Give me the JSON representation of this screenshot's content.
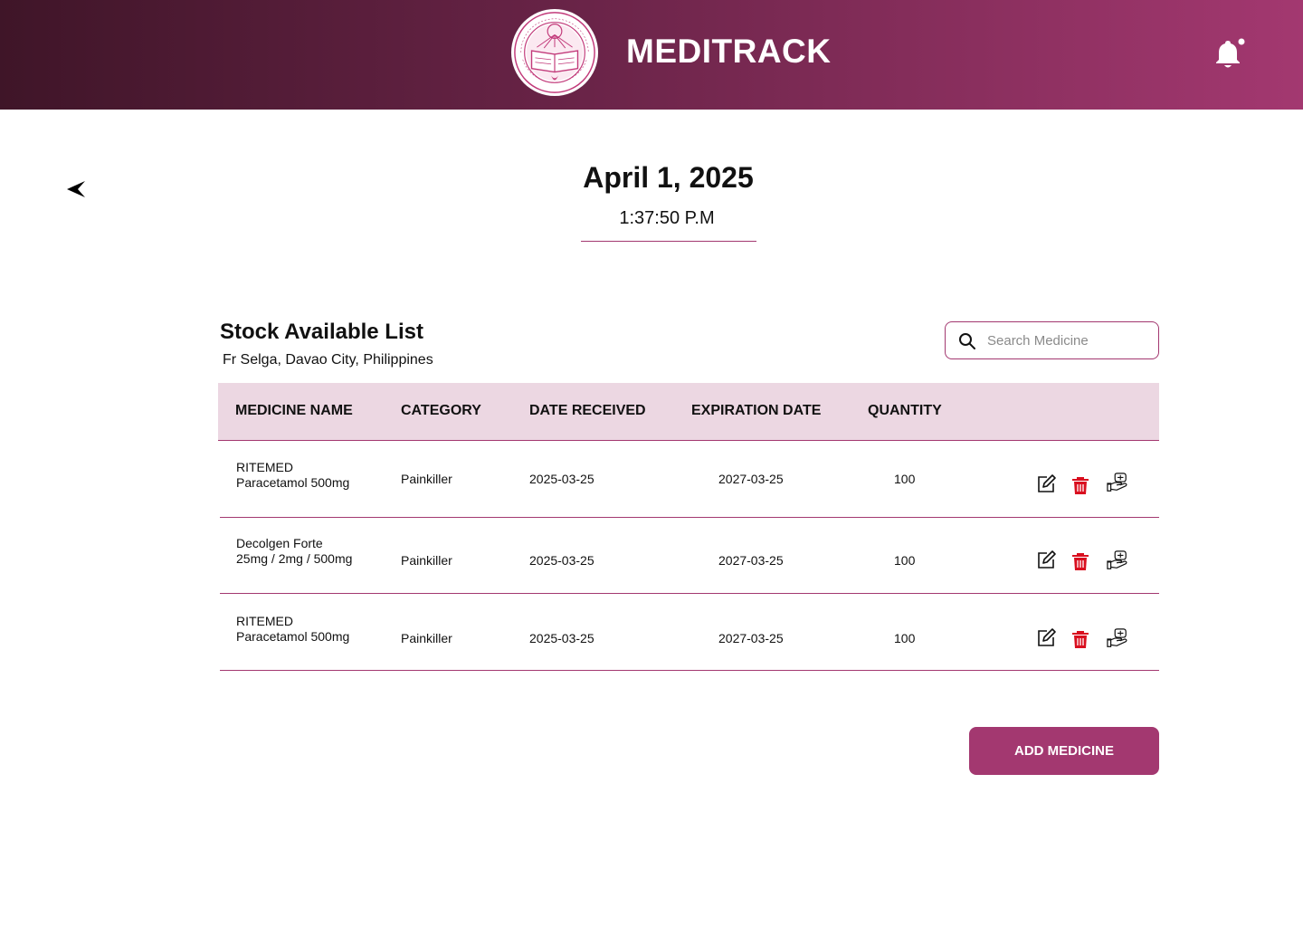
{
  "header": {
    "app_title": "MEDITRACK",
    "logo_icon": "university-seal-icon",
    "notification_icon": "bell-icon",
    "brand_color": "#a33870"
  },
  "datetime": {
    "date": "April 1, 2025",
    "time": "1:37:50 P.M"
  },
  "section": {
    "title": "Stock Available List",
    "subtitle": "Fr Selga, Davao City, Philippines"
  },
  "search": {
    "placeholder": "Search Medicine",
    "value": ""
  },
  "table": {
    "columns": [
      "MEDICINE NAME",
      "CATEGORY",
      "DATE RECEIVED",
      "EXPIRATION DATE",
      "QUANTITY"
    ],
    "rows": [
      {
        "name": "RITEMED Paracetamol 500mg",
        "category": "Painkiller",
        "date_received": "2025-03-25",
        "expiration_date": "2027-03-25",
        "quantity": "100"
      },
      {
        "name": "Decolgen Forte 25mg / 2mg / 500mg",
        "category": "Painkiller",
        "date_received": "2025-03-25",
        "expiration_date": "2027-03-25",
        "quantity": "100"
      },
      {
        "name": "RITEMED Paracetamol 500mg",
        "category": "Painkiller",
        "date_received": "2025-03-25",
        "expiration_date": "2027-03-25",
        "quantity": "100"
      }
    ],
    "row_action_icons": [
      "edit-icon",
      "trash-icon",
      "dispense-hand-icon"
    ]
  },
  "actions": {
    "add_label": "ADD MEDICINE"
  }
}
